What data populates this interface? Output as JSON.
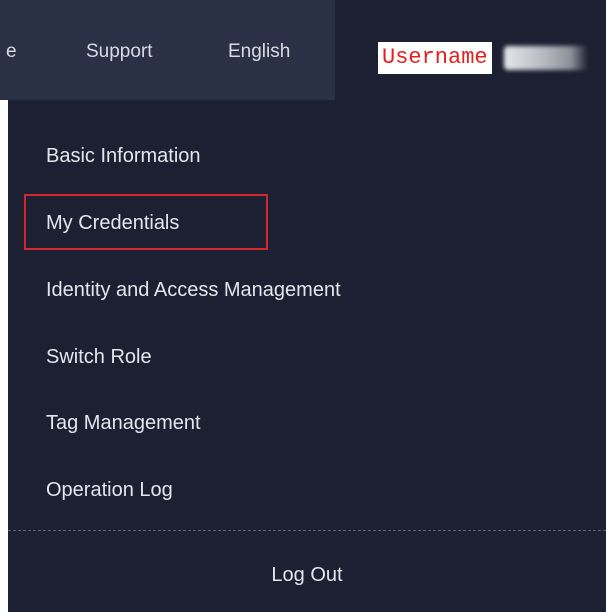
{
  "topbar": {
    "clipped_item_label": "e",
    "support_label": "Support",
    "language_label": "English",
    "username_label": "Username"
  },
  "menu": {
    "items": [
      {
        "label": "Basic Information"
      },
      {
        "label": "My Credentials",
        "highlighted": true
      },
      {
        "label": "Identity and Access Management"
      },
      {
        "label": "Switch Role"
      },
      {
        "label": "Tag Management"
      },
      {
        "label": "Operation Log"
      }
    ],
    "logout_label": "Log Out"
  },
  "colors": {
    "topbar_bg": "#2a3147",
    "menu_bg": "#1c2032",
    "text": "#e4e6ec",
    "highlight_border": "#d2272c",
    "username_text": "#e51e1e"
  }
}
